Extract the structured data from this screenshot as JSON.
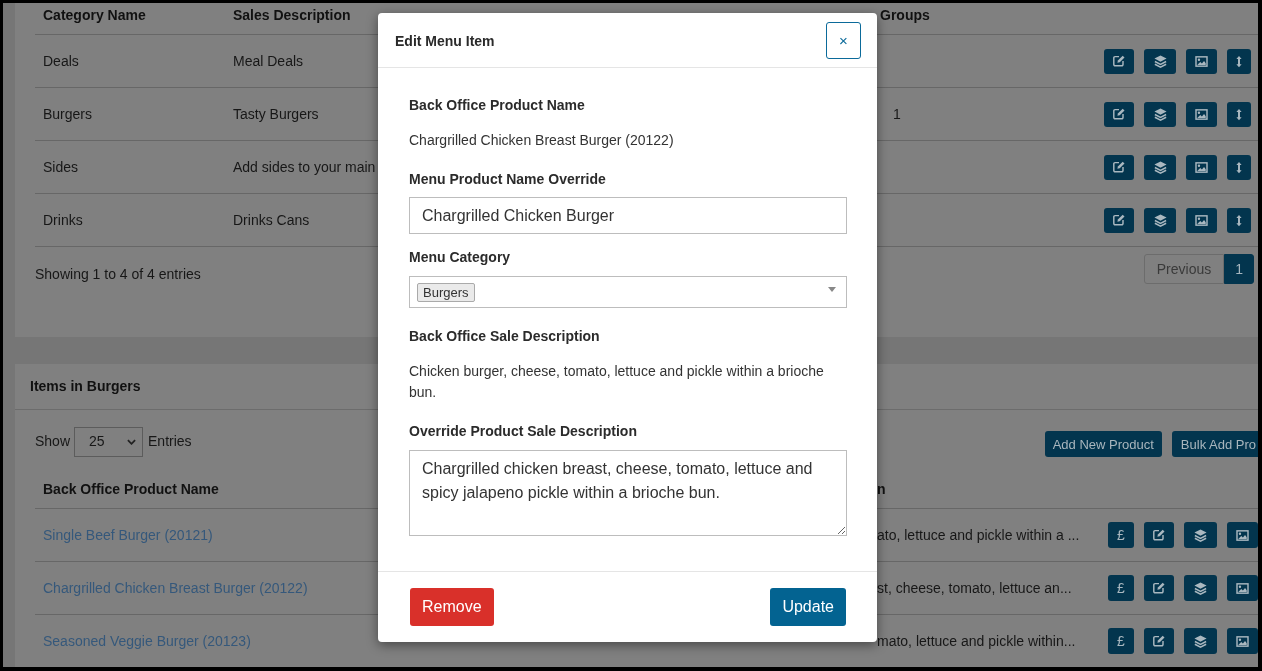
{
  "categories": {
    "table": {
      "columns": [
        "Category Name",
        "Sales Description",
        "Groups"
      ],
      "rows": [
        {
          "name": "Deals",
          "description": "Meal Deals"
        },
        {
          "name": "Burgers",
          "description": "Tasty Burgers",
          "groups": "1"
        },
        {
          "name": "Sides",
          "description": "Add sides to your main"
        },
        {
          "name": "Drinks",
          "description": "Drinks Cans"
        }
      ]
    },
    "summary": "Showing 1 to 4 of 4 entries",
    "pages": [
      {
        "label": "Previous",
        "selected": false
      },
      {
        "label": "1",
        "selected": true
      }
    ]
  },
  "items": {
    "title": "Items in Burgers",
    "show_label": "Show",
    "page_length": "25",
    "entries_label": "Entries",
    "buttons": [
      "Add New Product",
      "Bulk Add Pro"
    ],
    "table": {
      "columns": [
        "Back Office Product Name",
        "n"
      ],
      "rows": [
        {
          "name": "Single Beef Burger (20121)",
          "description": "ato, lettuce and pickle within a ...",
          "price_symbol": "£"
        },
        {
          "name": "Chargrilled Chicken Breast Burger (20122)",
          "description": "st, cheese, tomato, lettuce an...",
          "price_symbol": "£"
        },
        {
          "name": "Seasoned Veggie Burger (20123)",
          "description": "mato, lettuce and pickle within...",
          "price_symbol": "£"
        }
      ]
    }
  },
  "modal": {
    "title": "Edit Menu Item",
    "close_label": "×",
    "fields": [
      {
        "kind": "static",
        "label": "Back Office Product Name",
        "value": "Chargrilled Chicken Breast Burger (20122)"
      },
      {
        "kind": "input",
        "label": "Menu Product Name Override",
        "value": "Chargrilled Chicken Burger"
      },
      {
        "kind": "select",
        "label": "Menu Category",
        "tags": [
          "Burgers"
        ]
      },
      {
        "kind": "static",
        "label": "Back Office Sale Description",
        "value": "Chicken burger, cheese, tomato, lettuce and pickle within a brioche bun."
      },
      {
        "kind": "textarea",
        "label": "Override Product Sale Description",
        "value": "Chargrilled chicken breast, cheese, tomato, lettuce and spicy jalapeno pickle within a brioche bun."
      }
    ],
    "buttons": [
      {
        "kind": "danger",
        "label": "Remove"
      },
      {
        "kind": "primary",
        "label": "Update"
      }
    ]
  }
}
